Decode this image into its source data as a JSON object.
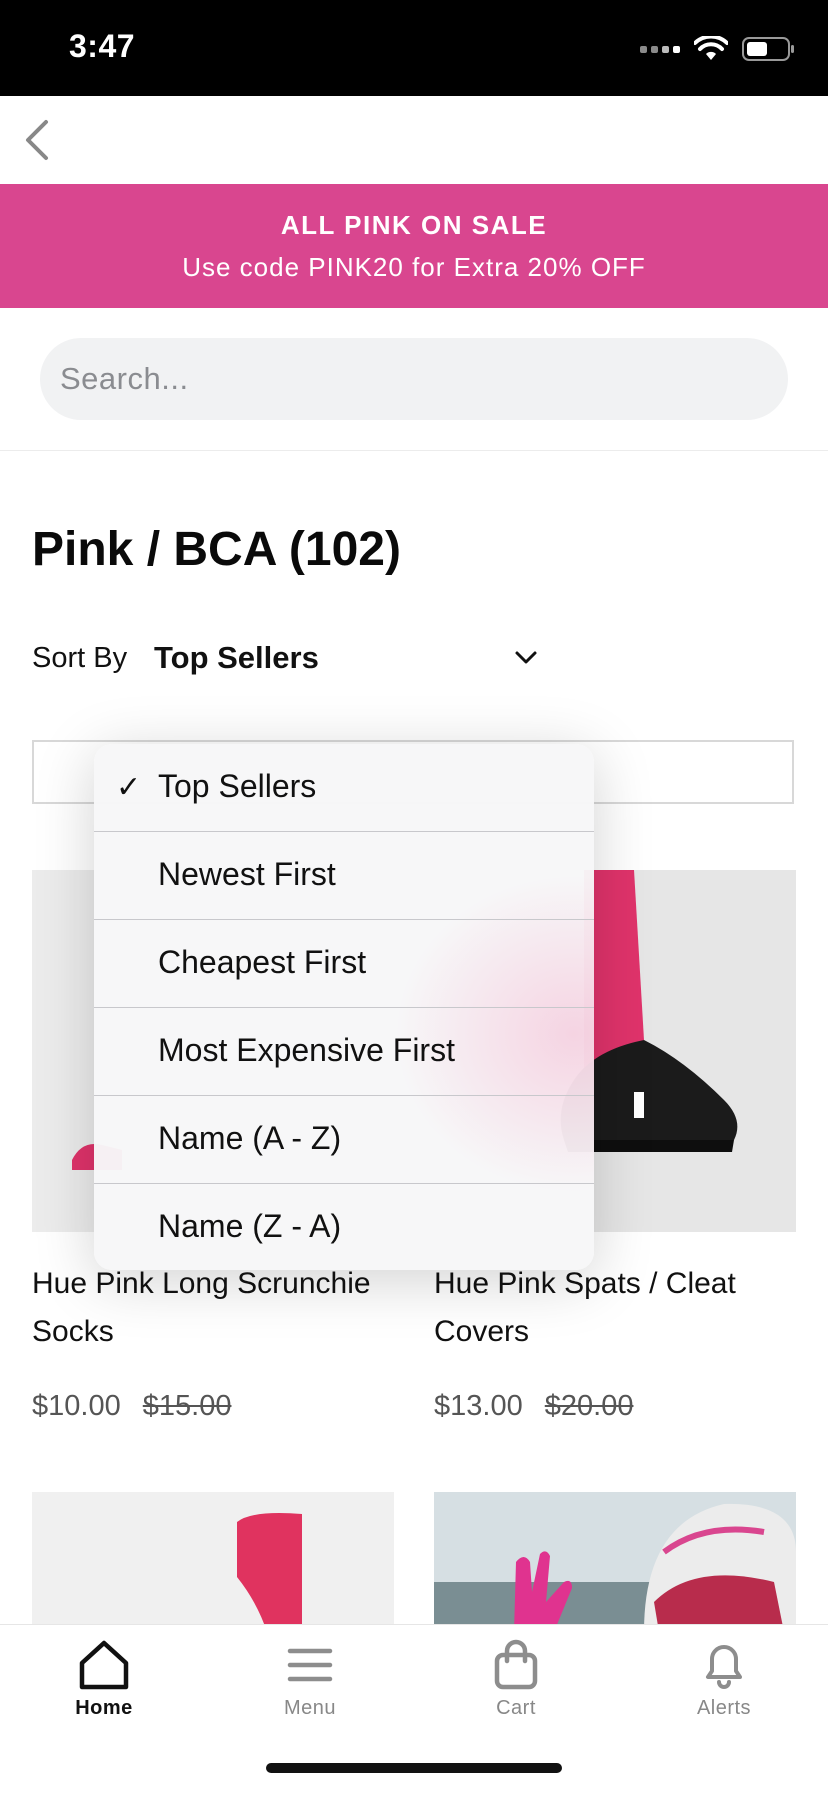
{
  "status_bar": {
    "time": "3:47"
  },
  "promo": {
    "title": "ALL PINK ON SALE",
    "subtitle": "Use code PINK20 for Extra 20% OFF",
    "background_color": "#d9468f"
  },
  "search": {
    "placeholder": "Search..."
  },
  "page": {
    "title": "Pink / BCA (102)"
  },
  "sort": {
    "label": "Sort By",
    "selected": "Top Sellers",
    "options": [
      {
        "label": "Top Sellers",
        "checked": true
      },
      {
        "label": "Newest First",
        "checked": false
      },
      {
        "label": "Cheapest First",
        "checked": false
      },
      {
        "label": "Most Expensive First",
        "checked": false
      },
      {
        "label": "Name (A - Z)",
        "checked": false
      },
      {
        "label": "Name (Z - A)",
        "checked": false
      }
    ],
    "check_glyph": "✓"
  },
  "products": [
    {
      "name": "Hue Pink Long Scrunchie Socks",
      "price": "$10.00",
      "old_price": "$15.00"
    },
    {
      "name": "Hue Pink Spats / Cleat Covers",
      "price": "$13.00",
      "old_price": "$20.00"
    }
  ],
  "tabs": [
    {
      "label": "Home",
      "icon": "home-icon",
      "active": true
    },
    {
      "label": "Menu",
      "icon": "menu-icon",
      "active": false
    },
    {
      "label": "Cart",
      "icon": "bag-icon",
      "active": false
    },
    {
      "label": "Alerts",
      "icon": "bell-icon",
      "active": false
    }
  ]
}
